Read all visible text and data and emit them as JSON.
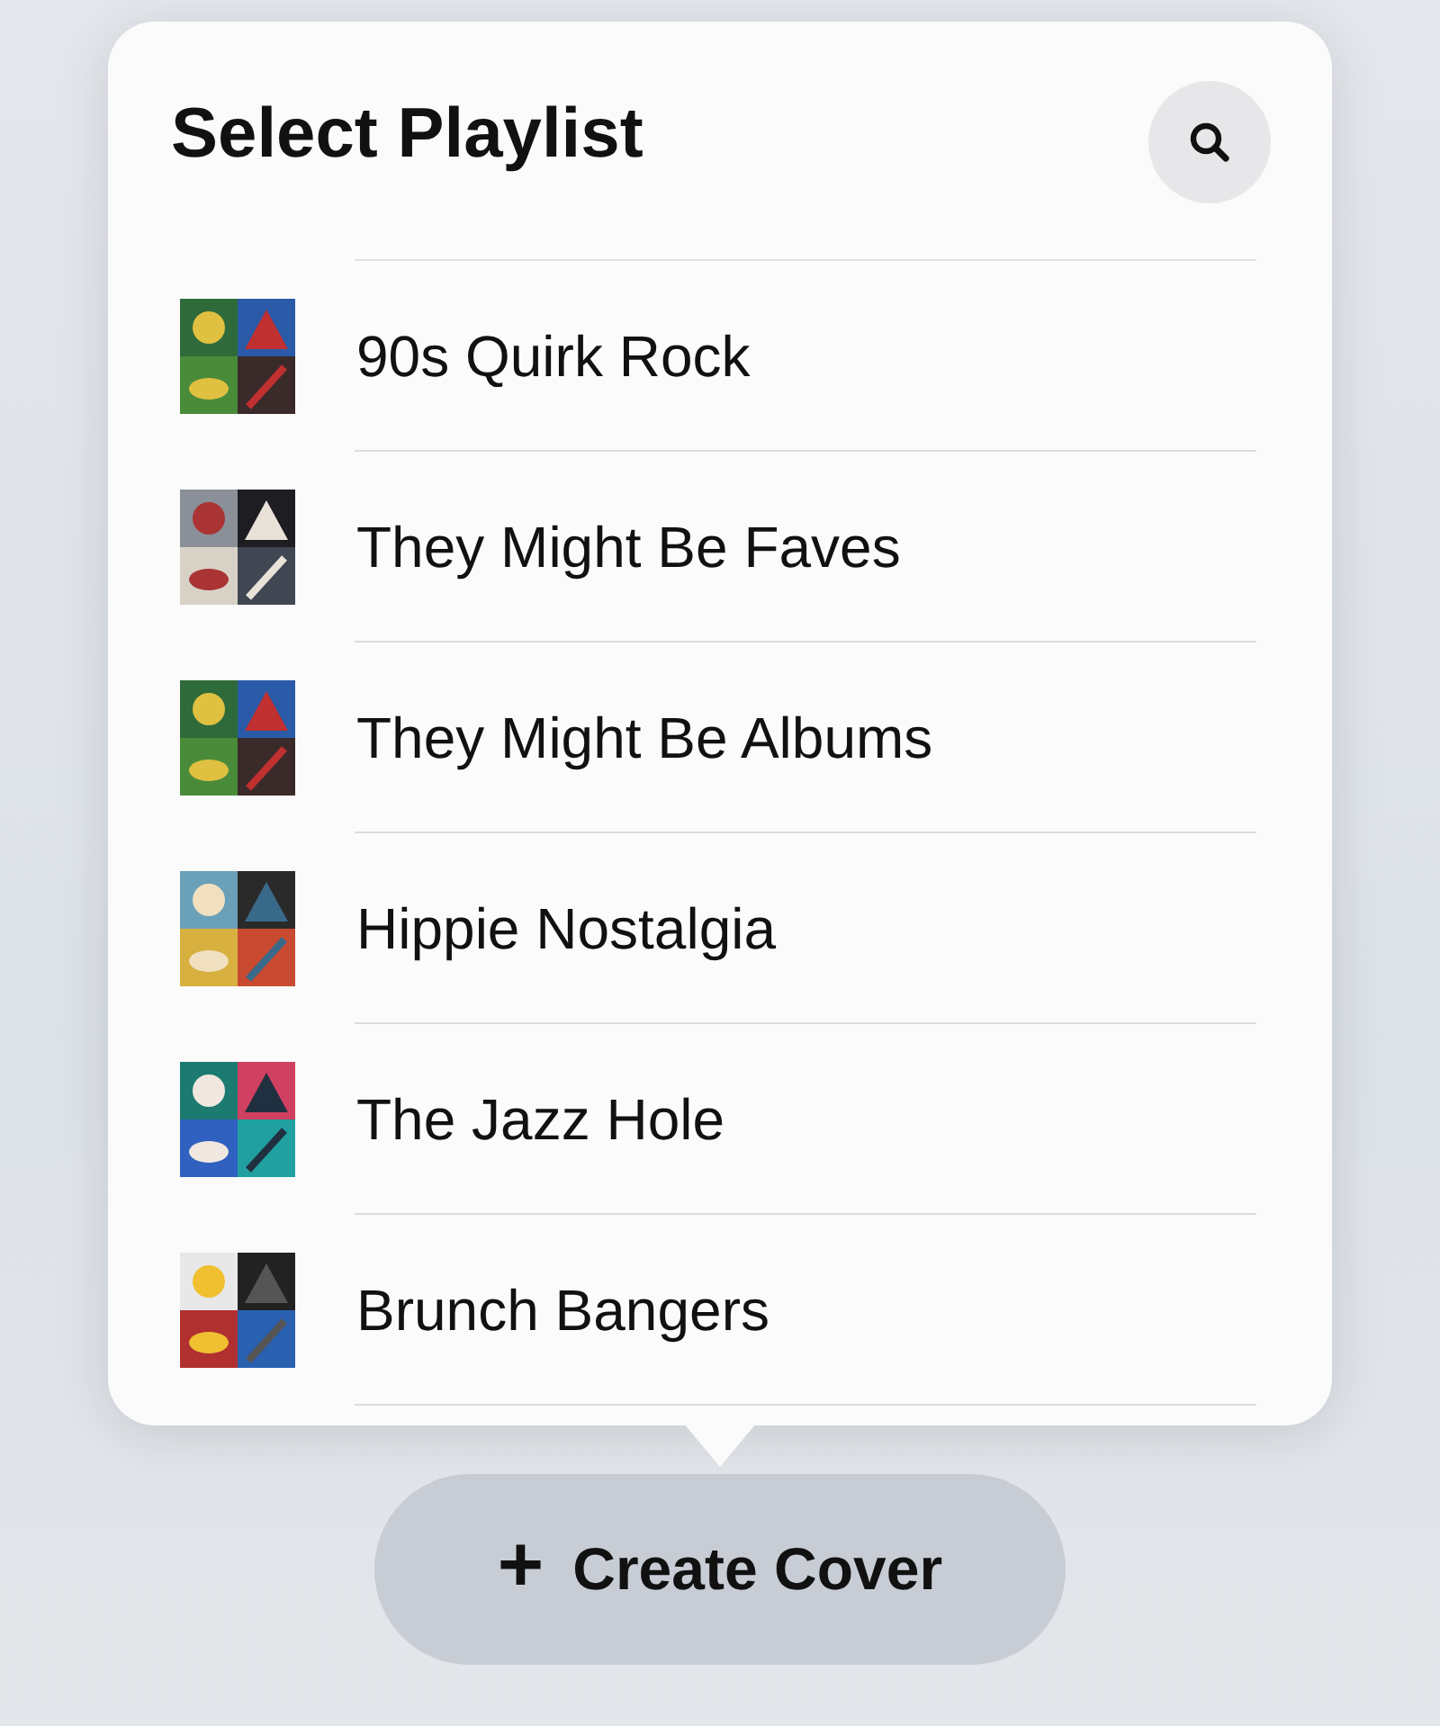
{
  "popover": {
    "title": "Select Playlist",
    "playlists": [
      {
        "name": "90s Quirk Rock"
      },
      {
        "name": "They Might Be Faves"
      },
      {
        "name": "They Might Be Albums"
      },
      {
        "name": "Hippie Nostalgia"
      },
      {
        "name": "The Jazz Hole"
      },
      {
        "name": "Brunch Bangers"
      }
    ]
  },
  "create_button": {
    "icon": "+",
    "label": "Create Cover"
  }
}
